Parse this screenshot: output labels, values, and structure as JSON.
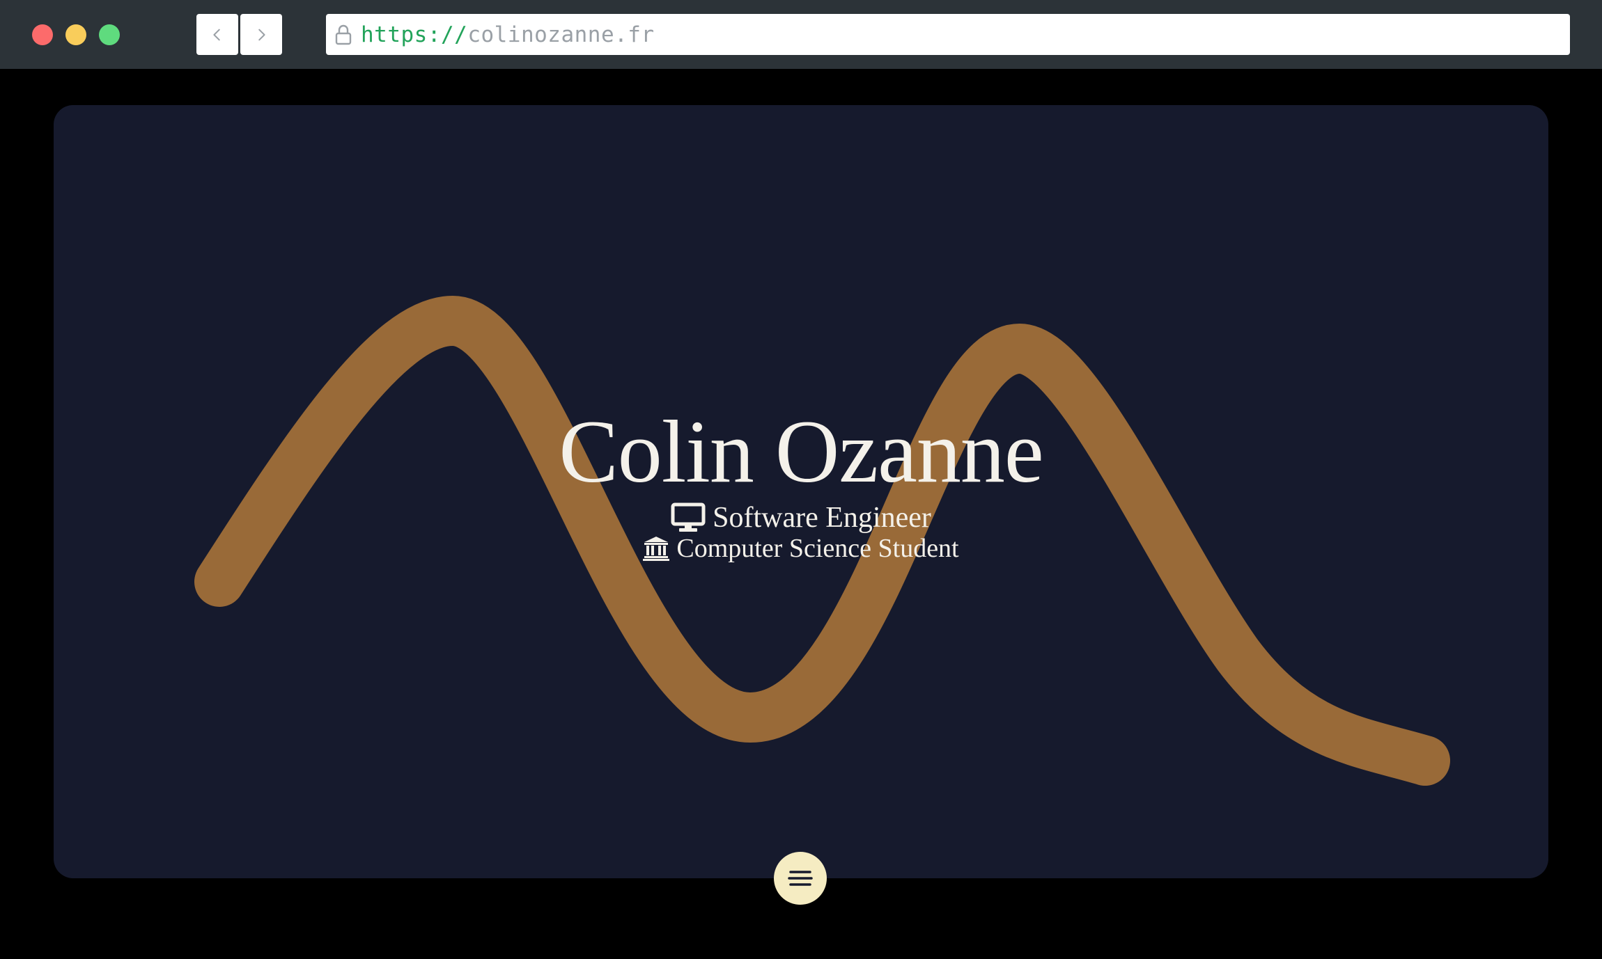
{
  "browser": {
    "url_scheme": "https://",
    "url_host": "colinozanne.fr",
    "icons": {
      "back": "chevron-left-icon",
      "forward": "chevron-right-icon",
      "lock": "lock-icon"
    }
  },
  "hero": {
    "name": "Colin Ozanne",
    "roles": [
      {
        "icon": "monitor-icon",
        "label": "Software Engineer"
      },
      {
        "icon": "institution-icon",
        "label": "Computer Science Student"
      }
    ]
  },
  "menu": {
    "icon": "menu-icon"
  },
  "colors": {
    "page_background": "#000000",
    "chrome": "#2c3338",
    "viewport": "#161a2d",
    "wave": "#996a38",
    "hero_text": "#f4f1ea",
    "menu_button": "#f5ecc2",
    "url_scheme": "#22a35a",
    "url_host": "#9aa0a6"
  }
}
